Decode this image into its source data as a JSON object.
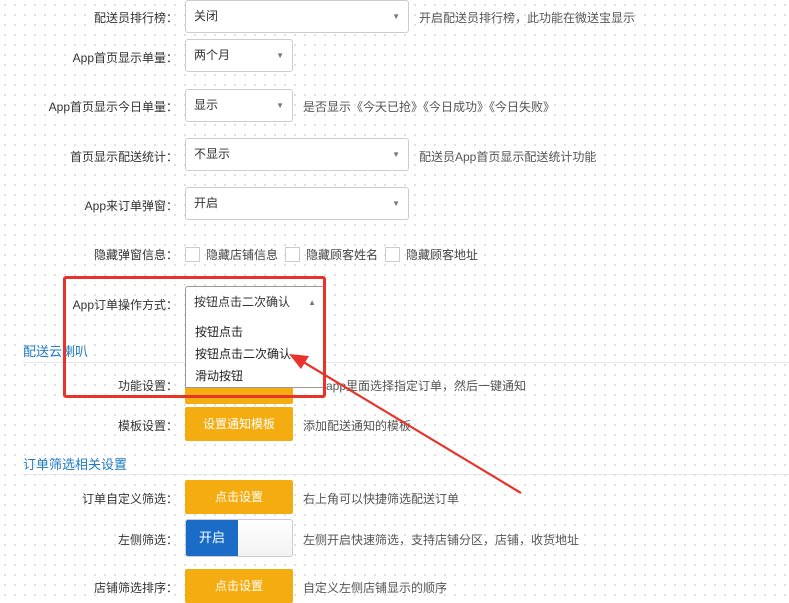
{
  "rows": {
    "rank": {
      "label": "配送员排行榜：",
      "value": "关闭",
      "help": "开启配送员排行榜，此功能在微送宝显示"
    },
    "home_count": {
      "label": "App首页显示单量：",
      "value": "两个月"
    },
    "today_count": {
      "label": "App首页显示今日单量：",
      "value": "显示",
      "help": "是否显示《今天已抢》《今日成功》《今日失败》"
    },
    "home_stats": {
      "label": "首页显示配送统计：",
      "value": "不显示",
      "help": "配送员App首页显示配送统计功能"
    },
    "order_popup": {
      "label": "App来订单弹窗：",
      "value": "开启"
    },
    "hide_info": {
      "label": "隐藏弹窗信息：",
      "options": [
        "隐藏店铺信息",
        "隐藏顾客姓名",
        "隐藏顾客地址"
      ]
    },
    "order_action": {
      "label": "App订单操作方式：",
      "value": "按钮点击二次确认",
      "dropdown": [
        "按钮点击",
        "按钮点击二次确认",
        "滑动按钮"
      ]
    }
  },
  "section_speaker": {
    "title": "配送云喇叭"
  },
  "speaker": {
    "function": {
      "label": "功能设置：",
      "help": "app里面选择指定订单，然后一键通知"
    },
    "template": {
      "label": "模板设置：",
      "button": "设置通知模板",
      "help": "添加配送通知的模板"
    }
  },
  "section_filter": {
    "title": "订单筛选相关设置"
  },
  "filter": {
    "custom": {
      "label": "订单自定义筛选：",
      "button": "点击设置",
      "help": "右上角可以快捷筛选配送订单"
    },
    "left": {
      "label": "左侧筛选：",
      "toggle": "开启",
      "toggle_state": "on",
      "help": "左侧开启快速筛选，支持店铺分区，店铺，收货地址"
    },
    "store_sort": {
      "label": "店铺筛选排序：",
      "button": "点击设置",
      "help": "自定义左侧店铺显示的顺序"
    }
  },
  "colors": {
    "accent": "#f5ac10",
    "toggle": "#1a6cc6",
    "annotation": "#e8332a",
    "section": "#1f7ac1"
  }
}
